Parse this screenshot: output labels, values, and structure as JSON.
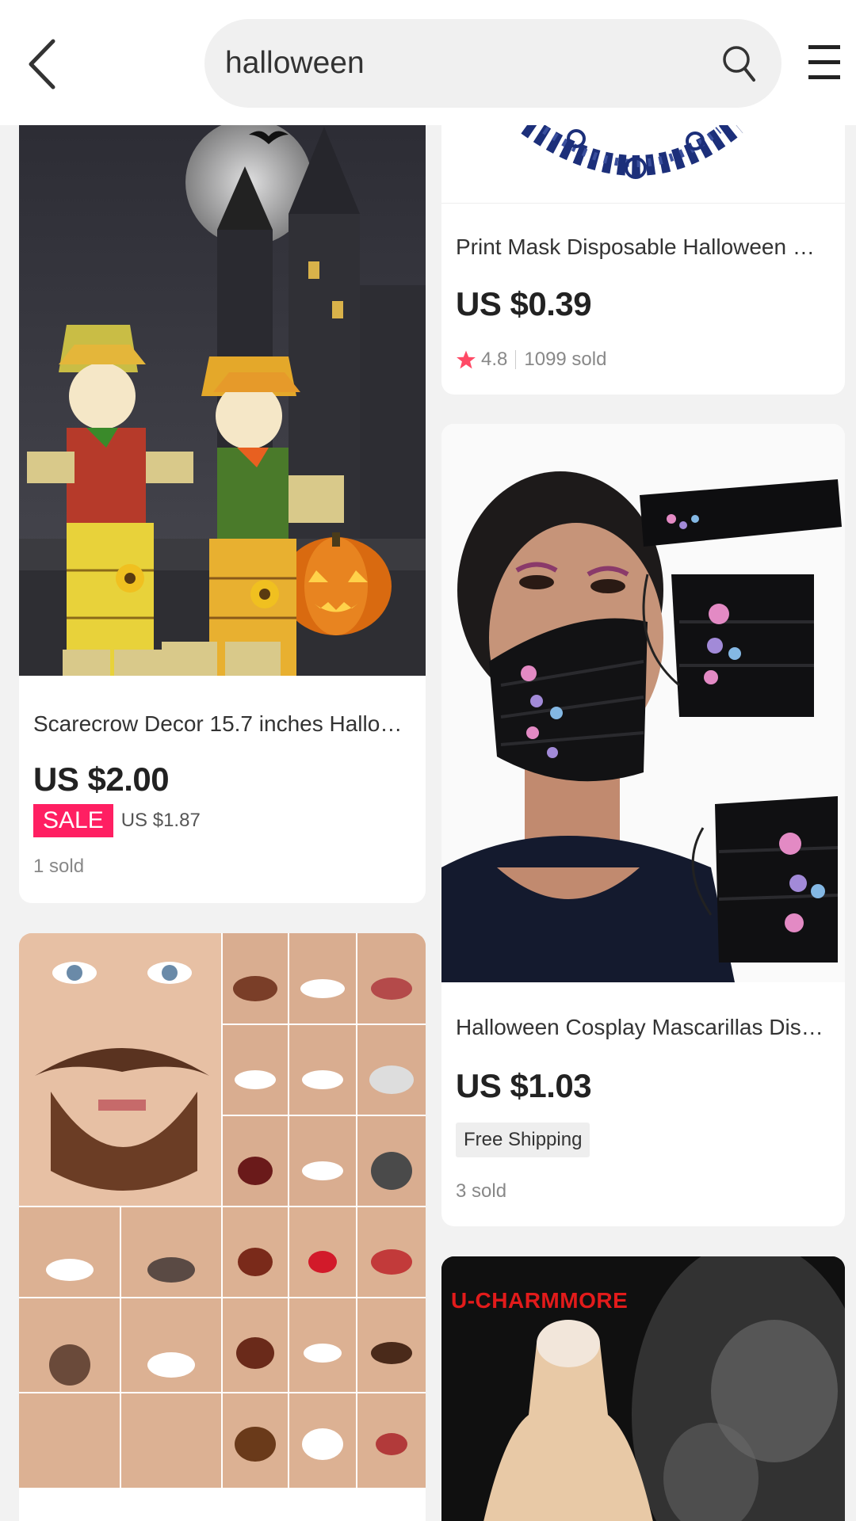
{
  "search": {
    "query": "halloween"
  },
  "products": {
    "mask_print": {
      "title": "Print Mask Disposable Halloween Cosp...",
      "price": "US $0.39",
      "rating": "4.8",
      "sold": "1099 sold"
    },
    "scarecrow": {
      "title": "Scarecrow Decor 15.7 inches Hallowee...",
      "price": "US $2.00",
      "sale_label": "SALE",
      "sale_price": "US $1.87",
      "sold": "1 sold"
    },
    "butterfly_mask": {
      "title": "Halloween Cosplay Mascarillas Dispos...",
      "price": "US $1.03",
      "shipping": "Free Shipping",
      "sold": "3 sold"
    },
    "face_masks": {},
    "silicone": {
      "brand": "U-CHARMMORE"
    }
  },
  "colors": {
    "sale": "#ff1f62",
    "star": "#ff4a66",
    "brand": "#e21b1b"
  },
  "icons": [
    "back-arrow-icon",
    "search-icon",
    "menu-icon",
    "star-icon"
  ]
}
